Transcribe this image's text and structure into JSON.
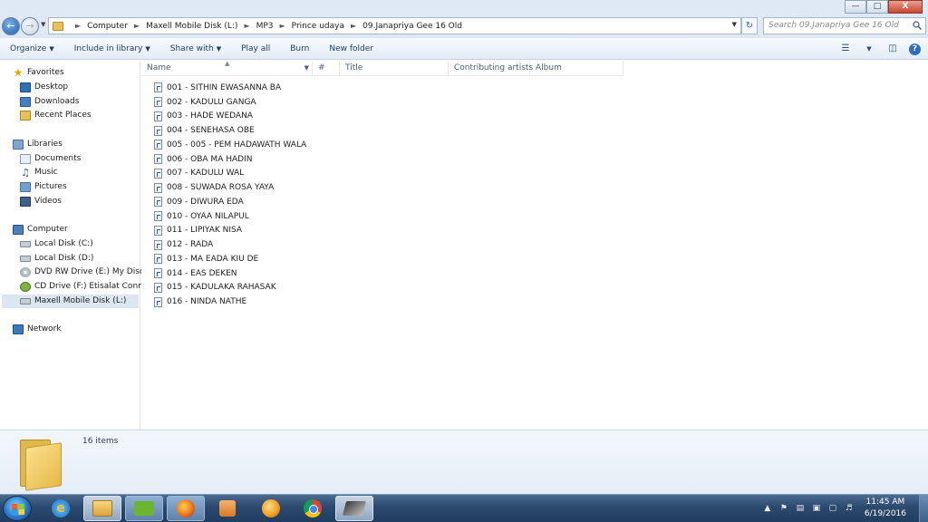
{
  "window": {
    "controls": {
      "minimize": "—",
      "maximize": "□",
      "close": "X"
    }
  },
  "address": {
    "crumbs": [
      "Computer",
      "Maxell Mobile Disk (L:)",
      "MP3",
      "Prince udaya",
      "09.Janapriya Gee 16 Old"
    ]
  },
  "search": {
    "placeholder": "Search 09.Janapriya Gee 16 Old"
  },
  "toolbar": {
    "organize": "Organize",
    "include_in_library": "Include in library",
    "share_with": "Share with",
    "play_all": "Play all",
    "burn": "Burn",
    "new_folder": "New folder"
  },
  "nav": {
    "favorites": "Favorites",
    "desktop": "Desktop",
    "downloads": "Downloads",
    "recent_places": "Recent Places",
    "libraries": "Libraries",
    "documents": "Documents",
    "music": "Music",
    "pictures": "Pictures",
    "videos": "Videos",
    "computer": "Computer",
    "local_c": "Local Disk (C:)",
    "local_d": "Local Disk (D:)",
    "dvd_e": "DVD RW Drive (E:) My Disc",
    "cd_f": "CD Drive (F:) Etisalat Connect",
    "maxell_l": "Maxell Mobile Disk (L:)",
    "network": "Network"
  },
  "columns": {
    "name": "Name",
    "number": "#",
    "title": "Title",
    "contributing_artists": "Contributing artists",
    "album": "Album"
  },
  "files": [
    "001 - SITHIN EWASANNA BA",
    "002 - KADULU GANGA",
    "003 - HADE WEDANA",
    "004 - SENEHASA OBE",
    "005 - 005 - PEM HADAWATH WALA",
    "006 - OBA MA HADIN",
    "007 - KADULU WAL",
    "008 - SUWADA ROSA YAYA",
    "009 - DIWURA EDA",
    "010 - OYAA NILAPUL",
    "011 - LIPIYAK NISA",
    "012 - RADA",
    "013 - MA EADA KIU DE",
    "014 - EAS DEKEN",
    "015 - KADULAKA RAHASAK",
    "016 - NINDA NATHE"
  ],
  "details": {
    "item_count": "16 items"
  },
  "taskbar": {
    "time": "11:45 AM",
    "date": "6/19/2016"
  },
  "colors": {
    "accent": "#2c4a6e",
    "selection": "#dce6f2"
  }
}
